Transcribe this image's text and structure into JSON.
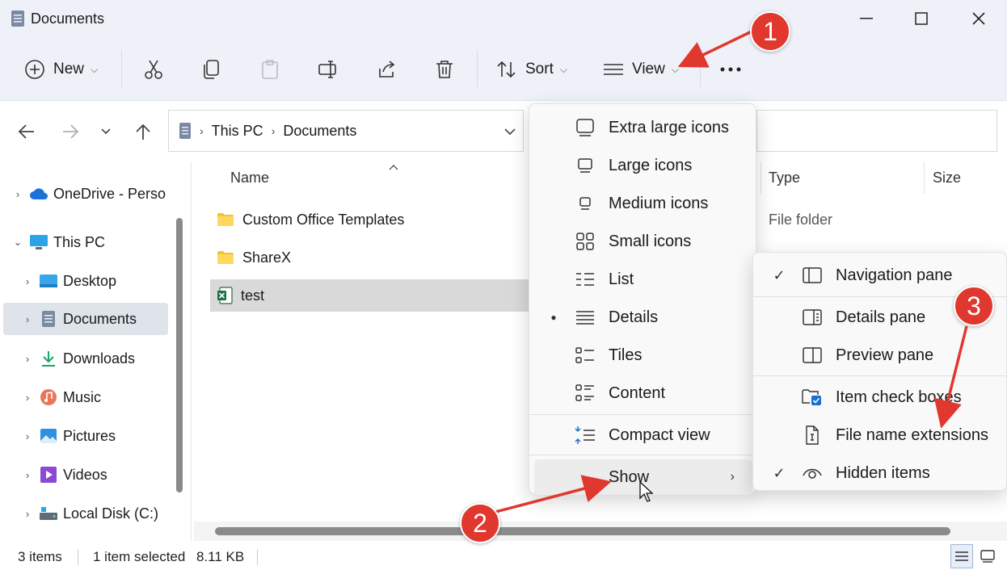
{
  "window": {
    "title": "Documents",
    "controls": [
      "minimize",
      "maximize",
      "close"
    ]
  },
  "toolbar": {
    "new_label": "New",
    "sort_label": "Sort",
    "view_label": "View",
    "icons": [
      "cut-icon",
      "copy-icon",
      "paste-icon",
      "rename-icon",
      "share-icon",
      "delete-icon",
      "more-icon"
    ]
  },
  "address": {
    "crumbs": [
      "This PC",
      "Documents"
    ]
  },
  "sidebar": {
    "items": [
      {
        "label": "OneDrive - Perso",
        "icon": "cloud-icon"
      },
      {
        "label": "This PC",
        "icon": "pc-icon"
      },
      {
        "label": "Desktop",
        "icon": "desktop-icon"
      },
      {
        "label": "Documents",
        "icon": "documents-icon",
        "selected": true
      },
      {
        "label": "Downloads",
        "icon": "download-icon"
      },
      {
        "label": "Music",
        "icon": "music-icon"
      },
      {
        "label": "Pictures",
        "icon": "pictures-icon"
      },
      {
        "label": "Videos",
        "icon": "videos-icon"
      },
      {
        "label": "Local Disk (C:)",
        "icon": "disk-icon"
      }
    ]
  },
  "file_list": {
    "columns": {
      "name": "Name",
      "type": "Type",
      "size": "Size"
    },
    "rows": [
      {
        "name": "Custom Office Templates",
        "type": "File folder",
        "icon": "folder-icon"
      },
      {
        "name": "ShareX",
        "icon": "folder-icon"
      },
      {
        "name": "test",
        "icon": "excel-icon",
        "selected": true
      }
    ]
  },
  "view_menu": {
    "items": [
      {
        "label": "Extra large icons"
      },
      {
        "label": "Large icons"
      },
      {
        "label": "Medium icons"
      },
      {
        "label": "Small icons"
      },
      {
        "label": "List"
      },
      {
        "label": "Details",
        "selected": true
      },
      {
        "label": "Tiles"
      },
      {
        "label": "Content"
      },
      {
        "label": "Compact view"
      },
      {
        "label": "Show",
        "has_submenu": true
      }
    ]
  },
  "show_submenu": {
    "items": [
      {
        "label": "Navigation pane",
        "checked": true
      },
      {
        "label": "Details pane"
      },
      {
        "label": "Preview pane"
      },
      {
        "label": "Item check boxes"
      },
      {
        "label": "File name extensions"
      },
      {
        "label": "Hidden items",
        "checked": true
      }
    ]
  },
  "status": {
    "items_count": "3 items",
    "selection": "1 item selected",
    "size": "8.11 KB"
  },
  "annotations": {
    "badges": [
      "1",
      "2",
      "3"
    ],
    "color": "#e0382e"
  }
}
